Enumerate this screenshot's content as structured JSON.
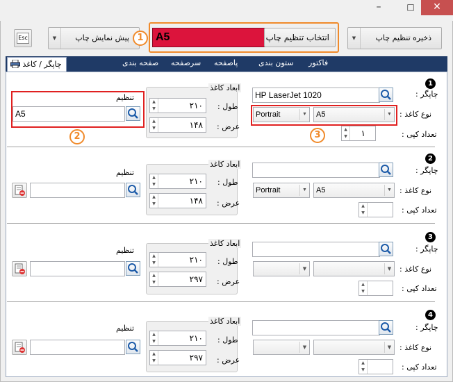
{
  "window": {
    "controls": {
      "minimize": "–",
      "maximize": "□",
      "close": "✕"
    }
  },
  "toolbar": {
    "esc_label": "Esc",
    "preview_label": "پیش نمایش چاپ",
    "select_setting_label": "انتخاب تنظیم چاپ",
    "selected_setting_value": "A5",
    "save_setting_label": "ذخیره تنظیم چاپ",
    "callout_1": "1"
  },
  "tabs": [
    {
      "label": "چاپگر / کاغذ",
      "active": true
    },
    {
      "label": "فاکتور"
    },
    {
      "label": "ستون بندی"
    },
    {
      "label": "پاصفحه"
    },
    {
      "label": "سرصفحه"
    },
    {
      "label": "صفحه بندی"
    }
  ],
  "labels": {
    "printer": "چاپگر :",
    "paper_type": "نوع کاغذ :",
    "copies": "تعداد کپی :",
    "setting": "تنظیم",
    "paper_size": "ابعاد کاغذ",
    "length": "طول :",
    "width": "عرض :"
  },
  "sections": [
    {
      "number": "1",
      "printer_name": "HP LaserJet 1020",
      "orientation": "Portrait",
      "paper": "A5",
      "copies": "۱",
      "setting_value": "A5",
      "length": "۲۱۰",
      "width": "۱۴۸",
      "callout_2": "2",
      "callout_3": "3"
    },
    {
      "number": "2",
      "printer_name": "",
      "orientation": "Portrait",
      "paper": "A5",
      "copies": "",
      "setting_value": "",
      "length": "۲۱۰",
      "width": "۱۴۸"
    },
    {
      "number": "3",
      "printer_name": "",
      "orientation": "",
      "paper": "",
      "copies": "",
      "setting_value": "",
      "length": "۲۱۰",
      "width": "۲۹۷"
    },
    {
      "number": "4",
      "printer_name": "",
      "orientation": "",
      "paper": "",
      "copies": "",
      "setting_value": "",
      "length": "۲۱۰",
      "width": "۲۹۷"
    }
  ],
  "colors": {
    "highlight_red": "#dc143c",
    "callout_orange": "#f08a2a",
    "tabbar_navy": "#1f3a66"
  }
}
